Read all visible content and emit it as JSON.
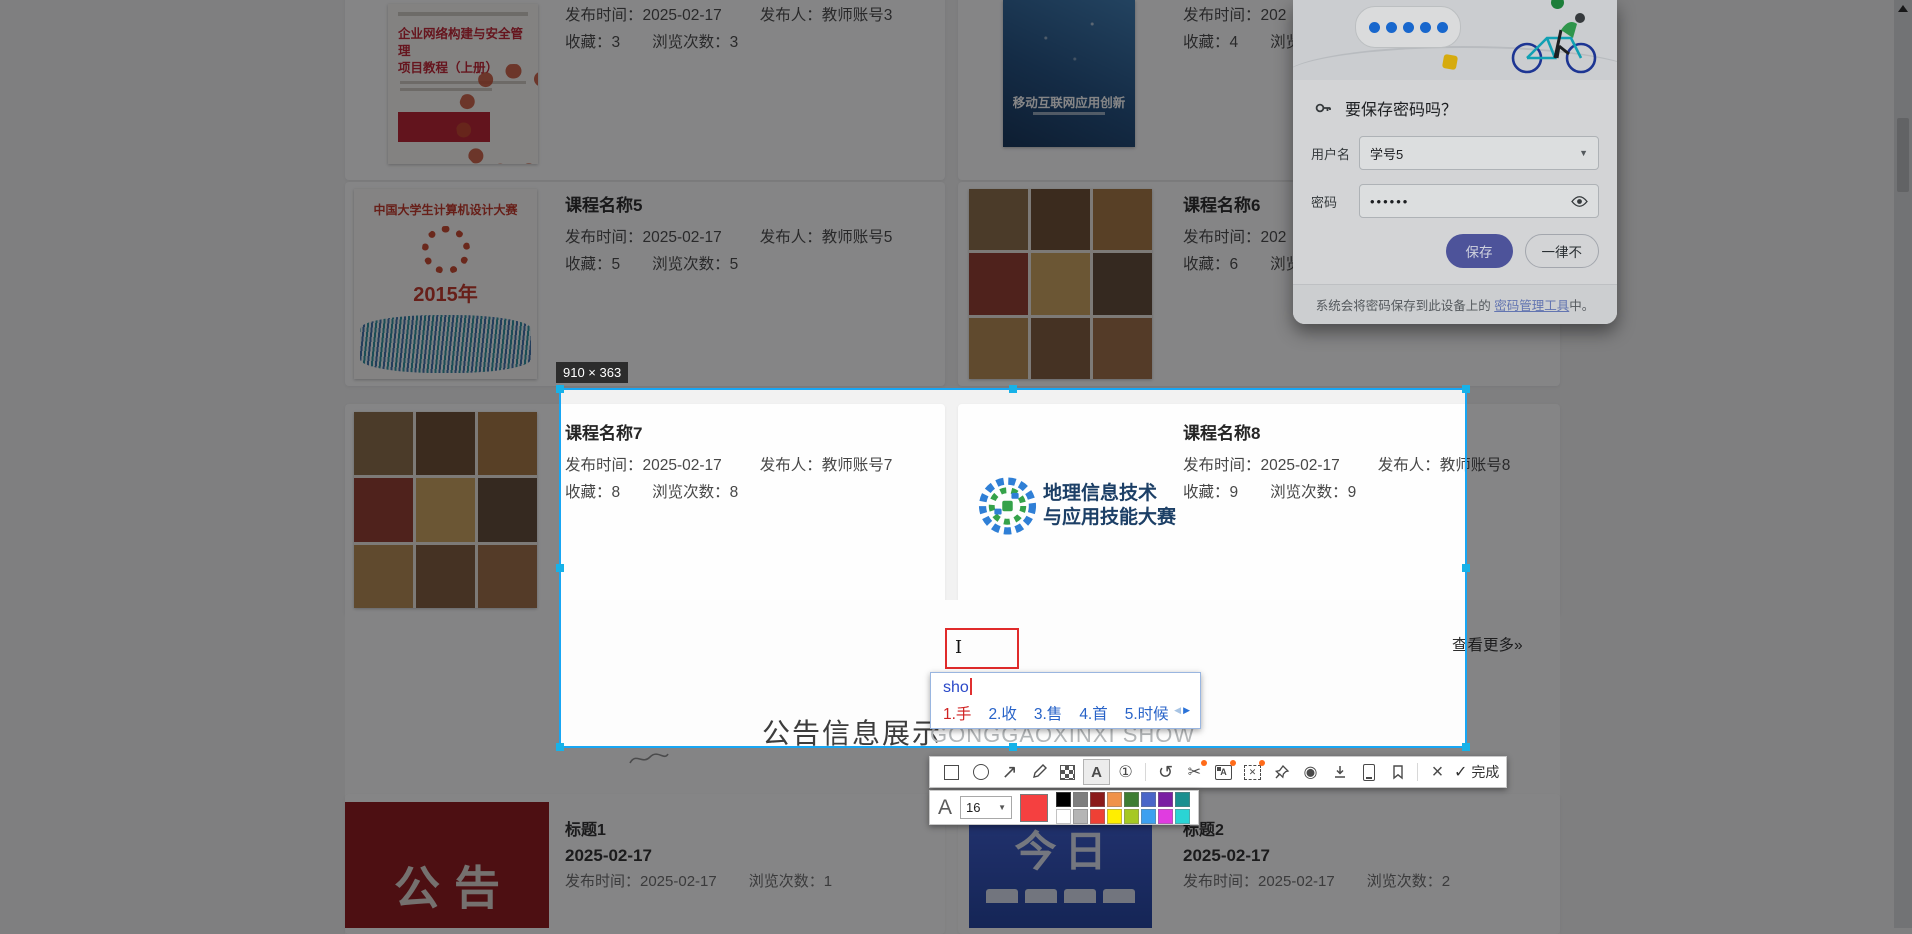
{
  "page": {
    "courses": {
      "c3": {
        "time": "发布时间：2025-02-17",
        "publisher": "发布人：教师账号3",
        "fav": "收藏：3",
        "views": "浏览次数：3",
        "cover_line1": "企业网络构建与安全管理",
        "cover_line2": "项目教程（上册）"
      },
      "c4": {
        "time": "发布时间：202",
        "fav": "收藏：4",
        "views": "浏览",
        "cover_line1": "移动互联网应用创新"
      },
      "c5": {
        "title": "课程名称5",
        "time": "发布时间：2025-02-17",
        "publisher": "发布人：教师账号5",
        "fav": "收藏：5",
        "views": "浏览次数：5",
        "cover_line1": "中国大学生计算机设计大赛",
        "cover_line2": "2015年"
      },
      "c6": {
        "title": "课程名称6",
        "time": "发布时间：202",
        "fav": "收藏：6",
        "views": "浏览"
      },
      "c7": {
        "title": "课程名称7",
        "time": "发布时间：2025-02-17",
        "publisher": "发布人：教师账号7",
        "fav": "收藏：8",
        "views": "浏览次数：8"
      },
      "c8": {
        "title": "课程名称8",
        "time": "发布时间：2025-02-17",
        "publisher": "发布人：教师账号8",
        "fav": "收藏：9",
        "views": "浏览次数：9",
        "logo_line1": "地理信息技术",
        "logo_line2": "与应用技能大赛"
      }
    },
    "more_link": "查看更多»",
    "section_title": "公告信息展示",
    "section_subtitle": "GONGGAOXINXI SHOW",
    "announcements": {
      "a1": {
        "title": "标题1",
        "date": "2025-02-17",
        "time": "发布时间：2025-02-17",
        "views": "浏览次数：1",
        "cover": "公告"
      },
      "a2": {
        "title": "标题2",
        "date": "2025-02-17",
        "time": "发布时间：2025-02-17",
        "views": "浏览次数：2",
        "cover": "今日"
      }
    }
  },
  "snip": {
    "size_label": "910 × 363",
    "selection_color": "#17a6f4",
    "annotation_color": "#e02b2b",
    "done_label": "完成",
    "font_letter": "A",
    "font_size": "16",
    "current_color": "#f54040",
    "palette": [
      "#000000",
      "#7f7f7f",
      "#8b1a1a",
      "#f0924a",
      "#3e7d33",
      "#4a66c8",
      "#7a1fa2",
      "#1a8f8f",
      "#ffffff",
      "#b5b5b5",
      "#ee4035",
      "#ffee00",
      "#a6c823",
      "#3da0f0",
      "#e03ce0",
      "#2ad4d4"
    ],
    "ime": {
      "composition": "sho",
      "candidates": [
        "1.手",
        "2.收",
        "3.售",
        "4.首",
        "5.时候"
      ]
    }
  },
  "password_dialog": {
    "title": "要保存密码吗？",
    "username_label": "用户名",
    "username_value": "学号5",
    "password_label": "密码",
    "password_value": "••••••",
    "save_label": "保存",
    "never_label": "一律不",
    "footer_prefix": "系统会将密码保存到此设备上的 ",
    "footer_link": "密码管理工具",
    "footer_suffix": "中。"
  }
}
